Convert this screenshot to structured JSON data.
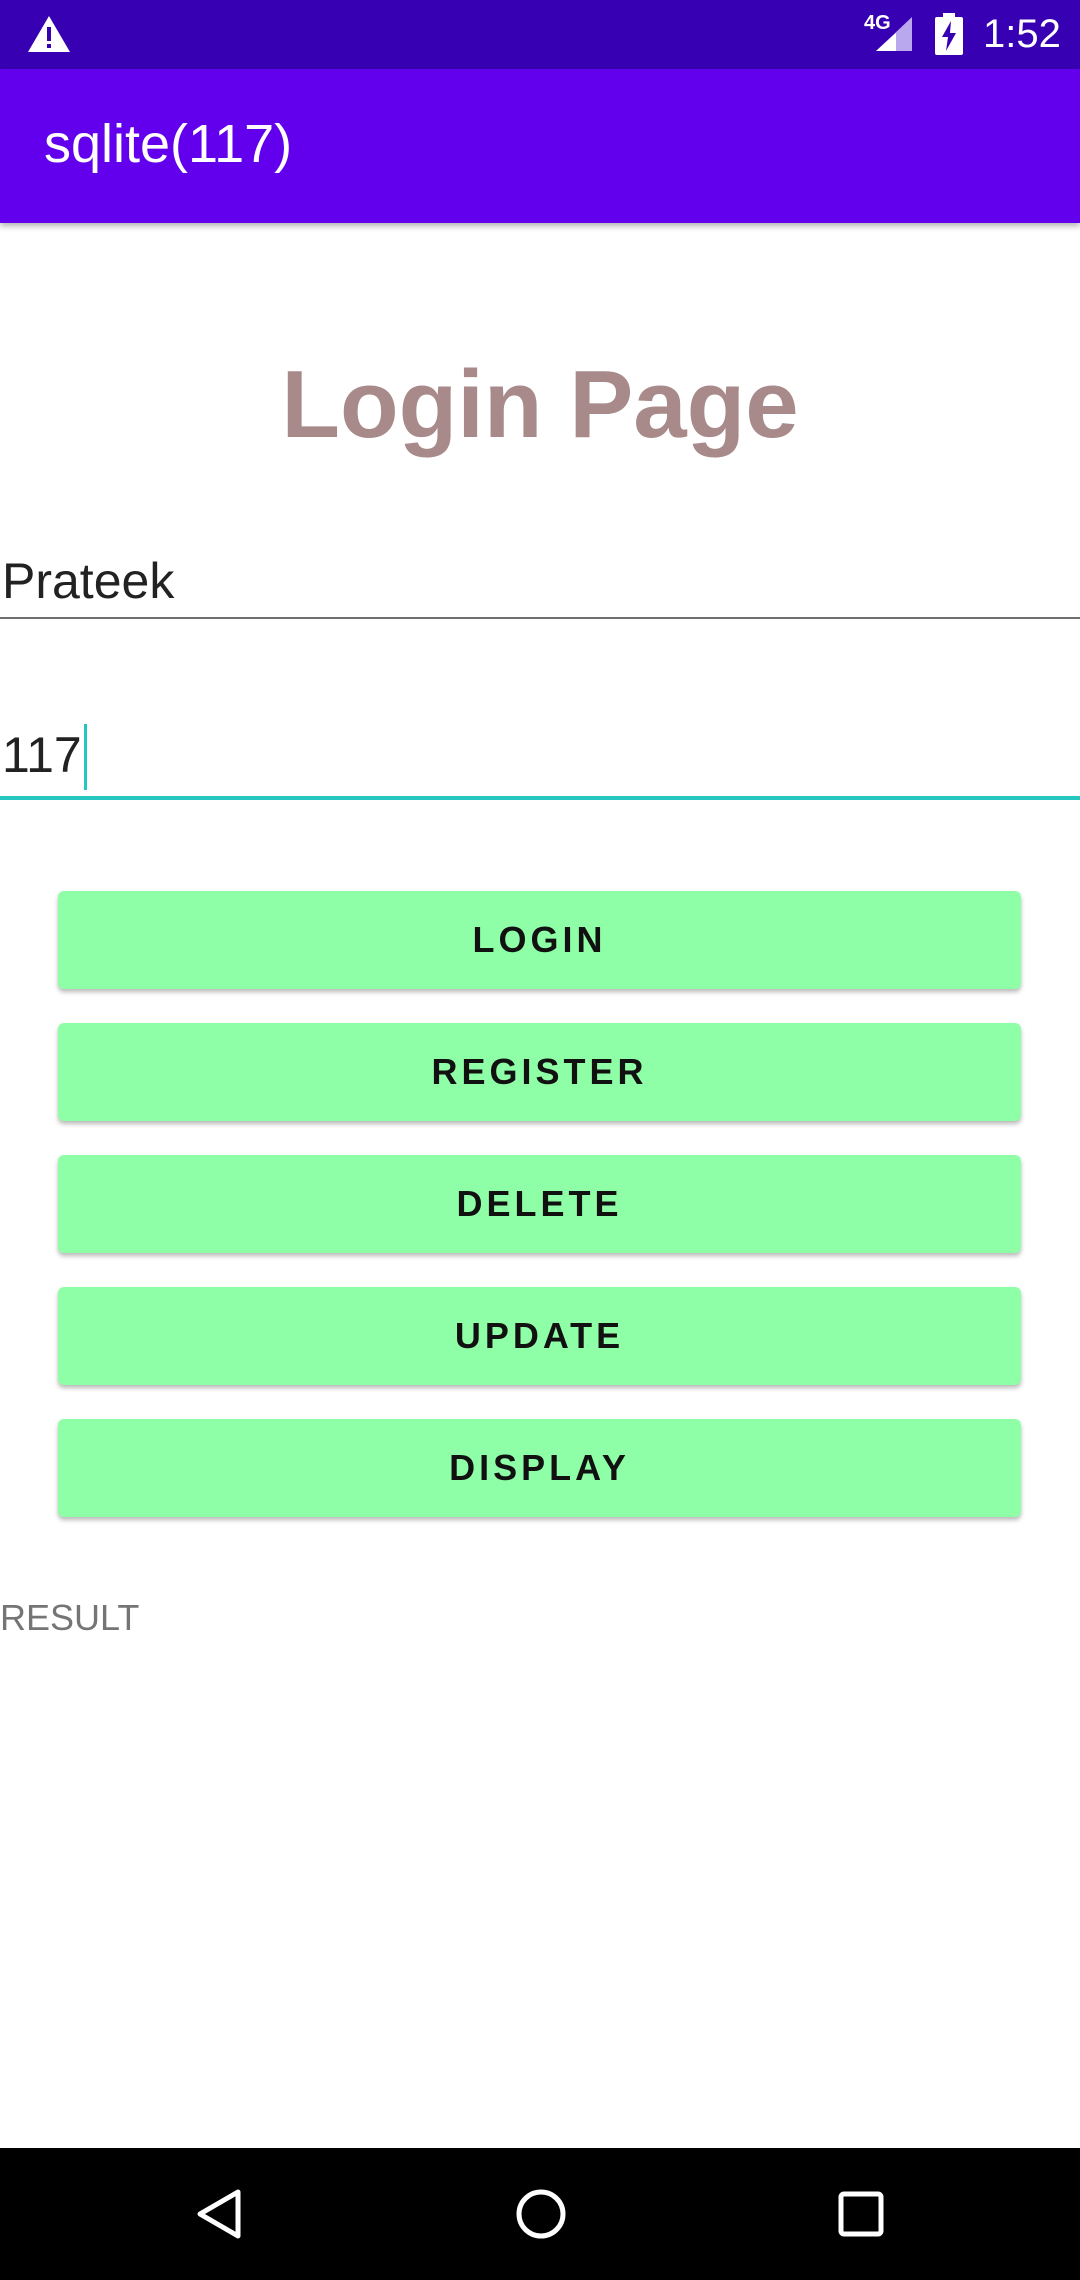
{
  "status_bar": {
    "network_type": "4G",
    "time": "1:52",
    "icons": [
      "warning-icon",
      "signal-icon",
      "battery-charging-icon"
    ]
  },
  "app_bar": {
    "title": "sqlite(117)"
  },
  "page": {
    "title": "Login Page"
  },
  "form": {
    "username_value": "Prateek",
    "password_value": "117"
  },
  "buttons": {
    "login": "LOGIN",
    "register": "REGISTER",
    "delete": "DELETE",
    "update": "UPDATE",
    "display": "DISPLAY"
  },
  "result": {
    "label": "RESULT"
  },
  "nav_bar": {
    "icons": [
      "back-icon",
      "home-icon",
      "recents-icon"
    ]
  },
  "colors": {
    "status_bar": "#3700b3",
    "app_bar": "#6200ee",
    "title_text": "#a88a8a",
    "button_bg": "#8effa6",
    "focus_accent": "#26c6c0"
  }
}
